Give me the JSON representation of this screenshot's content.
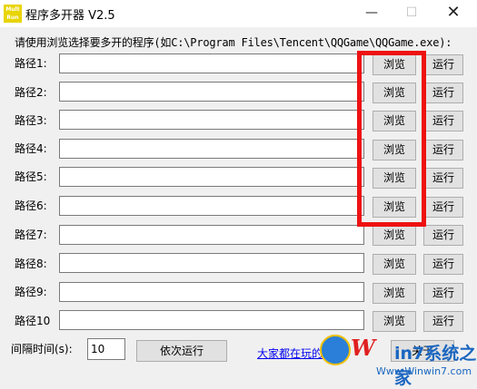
{
  "window": {
    "title": "程序多开器 V2.5",
    "icon_text": "Mult Run",
    "minimize_symbol": "—",
    "maximize_symbol": "☐",
    "close_symbol": "✕"
  },
  "instruction": "请使用浏览选择要多开的程序(如C:\\Program Files\\Tencent\\QQGame\\QQGame.exe):",
  "rows": [
    {
      "label": "路径1:",
      "value": "",
      "browse": "浏览",
      "run": "运行"
    },
    {
      "label": "路径2:",
      "value": "",
      "browse": "浏览",
      "run": "运行"
    },
    {
      "label": "路径3:",
      "value": "",
      "browse": "浏览",
      "run": "运行"
    },
    {
      "label": "路径4:",
      "value": "",
      "browse": "浏览",
      "run": "运行"
    },
    {
      "label": "路径5:",
      "value": "",
      "browse": "浏览",
      "run": "运行"
    },
    {
      "label": "路径6:",
      "value": "",
      "browse": "浏览",
      "run": "运行"
    },
    {
      "label": "路径7:",
      "value": "",
      "browse": "浏览",
      "run": "运行"
    },
    {
      "label": "路径8:",
      "value": "",
      "browse": "浏览",
      "run": "运行"
    },
    {
      "label": "路径9:",
      "value": "",
      "browse": "浏览",
      "run": "运行"
    },
    {
      "label": "路径10",
      "value": "",
      "browse": "浏览",
      "run": "运行"
    }
  ],
  "bottom": {
    "interval_label": "间隔时间(s):",
    "interval_value": "10",
    "sequential_run": "依次运行",
    "link_text": "大家都在玩的游戏",
    "about_button": "关于"
  },
  "watermark": {
    "brand_letter": "W",
    "site_name": "in7系统之家",
    "url": "Www.Winwin7.com"
  },
  "colors": {
    "highlight": "#ee1111",
    "link": "#0000ee"
  }
}
